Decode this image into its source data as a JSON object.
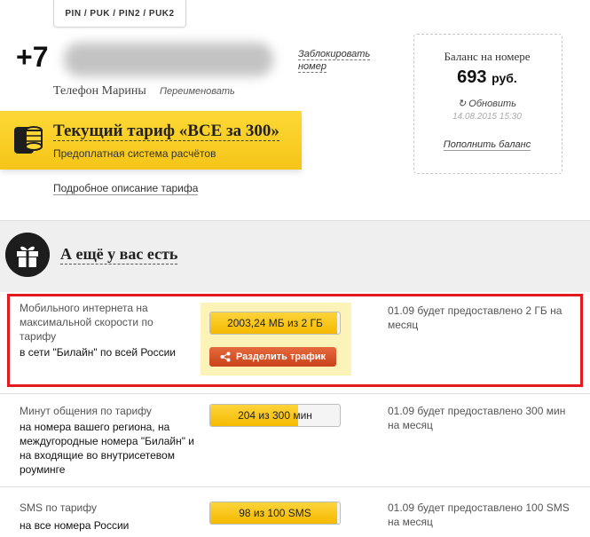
{
  "header": {
    "pin_button_label": "PIN / PUK / PIN2 / PUK2",
    "phone_prefix": "+7",
    "block_link": "Заблокировать номер",
    "phone_name": "Телефон Марины",
    "rename_link": "Переименовать"
  },
  "tariff": {
    "title": "Текущий тариф «ВСЕ за 300»",
    "subtitle": "Предоплатная система расчётов",
    "description_link": "Подробное описание тарифа"
  },
  "balance": {
    "label": "Баланс на номере",
    "amount": "693",
    "currency": "руб.",
    "refresh_label": "Обновить",
    "date": "14.08.2015 15:30",
    "topup_link": "Пополнить баланс"
  },
  "extras": {
    "title": "А ещё у вас есть"
  },
  "rows": [
    {
      "desc": "Мобильного интернета на максимальной скорости по тарифу",
      "scope": "в сети \"Билайн\" по всей России",
      "bar_label": "2003,24 МБ из 2 ГБ",
      "bar_fill_fraction": 0.98,
      "note": "01.09 будет предоставлено 2 ГБ на месяц",
      "share_label": "Разделить трафик"
    },
    {
      "desc": "Минут общения по тарифу",
      "scope": "на номера вашего региона, на междугородные номера \"Билайн\" и на входящие во внутрисетевом роуминге",
      "bar_label": "204 из 300 мин",
      "bar_fill_fraction": 0.68,
      "note": "01.09 будет предоставлено 300 мин на месяц"
    },
    {
      "desc": "SMS по тарифу",
      "scope": "на все номера России",
      "bar_label": "98 из 100 SMS",
      "bar_fill_fraction": 0.98,
      "note": "01.09 будет предоставлено 100 SMS на месяц"
    }
  ],
  "colors": {
    "brand_yellow": "#f5c518",
    "highlight_red": "#e2191f",
    "share_button": "#d4532a"
  }
}
